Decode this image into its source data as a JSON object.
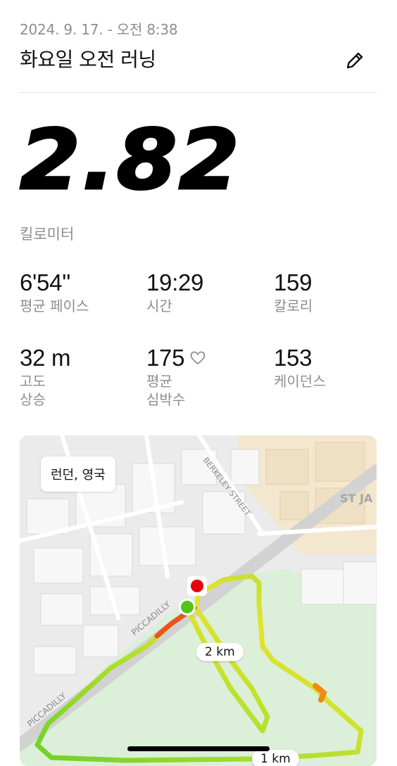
{
  "header": {
    "datetime": "2024. 9. 17. - 오전 8:38",
    "title": "화요일 오전 러닝",
    "edit_icon": "pencil-icon"
  },
  "summary": {
    "distance": "2.82",
    "distance_unit": "킬로미터"
  },
  "stats": [
    {
      "value": "6'54''",
      "label": "평균 페이스"
    },
    {
      "value": "19:29",
      "label": "시간"
    },
    {
      "value": "159",
      "label": "칼로리"
    },
    {
      "value": "32 m",
      "label": "고도\n상승"
    },
    {
      "value": "175",
      "label": "평균\n심박수",
      "icon": "heart-outline-icon"
    },
    {
      "value": "153",
      "label": "케이던스"
    }
  ],
  "map": {
    "location": "런던, 영국",
    "street_labels": [
      "BERKELEY STREET",
      "PICCADILLY",
      "PICCADILLY",
      "ST JA"
    ],
    "km_markers": [
      "2 km",
      "1 km"
    ],
    "start_color": "#52c41a",
    "end_color": "#e8000b"
  }
}
